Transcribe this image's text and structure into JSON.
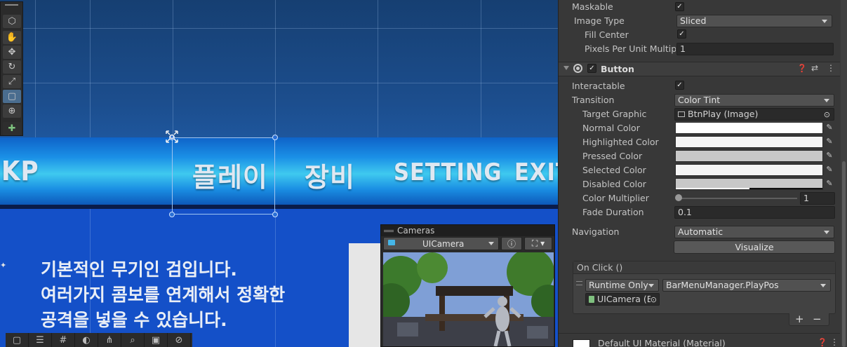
{
  "scene": {
    "menu_items": [
      "KP",
      "플레이",
      "장비",
      "SETTING",
      "EXIT"
    ],
    "description_lines": [
      "기본적인 무기인 검입니다.",
      "여러가지 콤보를 연계해서 정확한",
      "공격을 넣을 수 있습니다."
    ],
    "tools": [
      "view-icon",
      "hand-icon",
      "move-icon",
      "rotate-icon",
      "scale-icon",
      "rect-icon",
      "transform-icon",
      "custom-tool-icon"
    ],
    "bottom_tools": [
      "rect-icon",
      "layout-icon",
      "grid-icon",
      "sphere-icon",
      "nodes-icon",
      "search-icon",
      "camera-icon",
      "compass-icon"
    ]
  },
  "cameras": {
    "title": "Cameras",
    "selected_camera": "UICamera"
  },
  "inspector": {
    "image": {
      "maskable_label": "Maskable",
      "maskable_checked": true,
      "image_type_label": "Image Type",
      "image_type_value": "Sliced",
      "fill_center_label": "Fill Center",
      "fill_center_checked": true,
      "ppu_label": "Pixels Per Unit Multiplier",
      "ppu_value": "1"
    },
    "button": {
      "title": "Button",
      "enabled": true,
      "interactable_label": "Interactable",
      "interactable_checked": true,
      "transition_label": "Transition",
      "transition_value": "Color Tint",
      "target_graphic_label": "Target Graphic",
      "target_graphic_value": "BtnPlay (Image)",
      "normal_color_label": "Normal Color",
      "normal_color": "#ffffff",
      "highlighted_color_label": "Highlighted Color",
      "highlighted_color": "#f5f5f5",
      "pressed_color_label": "Pressed Color",
      "pressed_color": "#c8c8c8",
      "selected_color_label": "Selected Color",
      "selected_color": "#f5f5f5",
      "disabled_color_label": "Disabled Color",
      "disabled_color": "#c8c8c8",
      "color_multiplier_label": "Color Multiplier",
      "color_multiplier_value": "1",
      "fade_duration_label": "Fade Duration",
      "fade_duration_value": "0.1",
      "navigation_label": "Navigation",
      "navigation_value": "Automatic",
      "visualize_label": "Visualize"
    },
    "on_click": {
      "title": "On Click ()",
      "runtime_value": "Runtime Only",
      "function_value": "BarMenuManager.PlayPos",
      "object_value": "UICamera (E",
      "add_label": "+",
      "remove_label": "−"
    },
    "material": {
      "label": "Default UI Material (Material)"
    }
  }
}
